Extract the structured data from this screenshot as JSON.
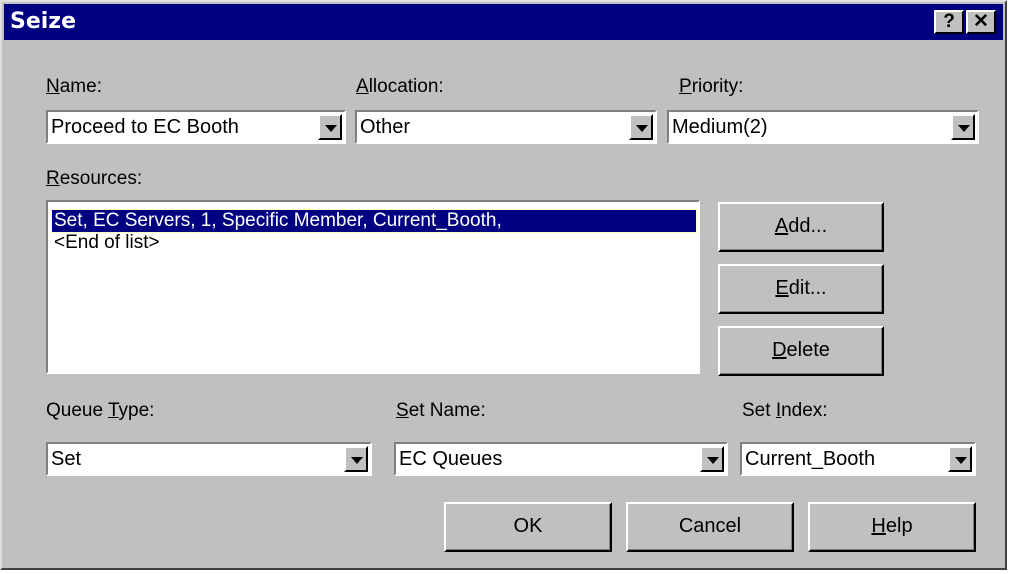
{
  "window": {
    "title": "Seize",
    "help_btn": "?",
    "close_btn": "✕"
  },
  "fields": {
    "name": {
      "label_u": "N",
      "label_rest": "ame:",
      "value": "Proceed to EC Booth"
    },
    "allocation": {
      "label_u": "A",
      "label_rest": "llocation:",
      "value": "Other"
    },
    "priority": {
      "label_u": "P",
      "label_rest": "riority:",
      "value": "Medium(2)"
    },
    "queue_type": {
      "label_pre": "Queue ",
      "label_u": "T",
      "label_rest": "ype:",
      "value": "Set"
    },
    "set_name": {
      "label_u": "S",
      "label_rest": "et Name:",
      "value": "EC Queues"
    },
    "set_index": {
      "label_pre": "Set ",
      "label_u": "I",
      "label_rest": "ndex:",
      "value": "Current_Booth"
    }
  },
  "resources": {
    "label_u": "R",
    "label_rest": "esources:",
    "items": [
      "Set, EC Servers, 1, Specific Member, Current_Booth,",
      "<End of list>"
    ]
  },
  "side_buttons": {
    "add": {
      "u": "A",
      "rest": "dd..."
    },
    "edit": {
      "u": "E",
      "rest": "dit..."
    },
    "delete": {
      "u": "D",
      "rest": "elete"
    }
  },
  "bottom_buttons": {
    "ok": "OK",
    "cancel": "Cancel",
    "help": {
      "u": "H",
      "rest": "elp"
    }
  }
}
